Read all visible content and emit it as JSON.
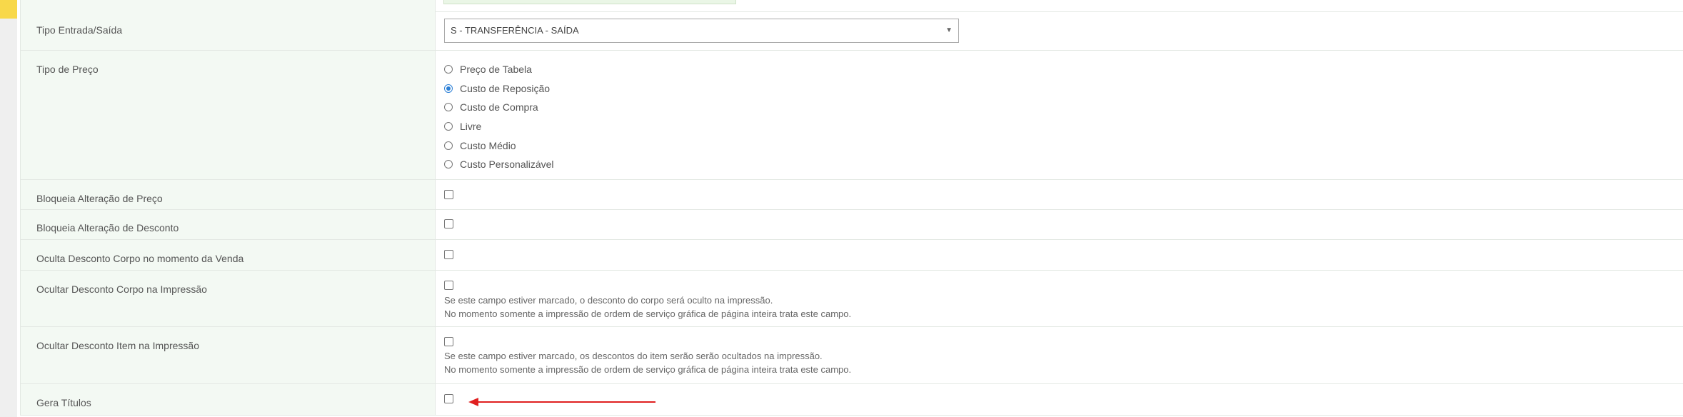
{
  "form": {
    "tipo_entrada_saida": {
      "label": "Tipo Entrada/Saída",
      "value": "S - TRANSFERÊNCIA - SAÍDA"
    },
    "tipo_preco": {
      "label": "Tipo de Preço",
      "options": [
        {
          "label": "Preço de Tabela",
          "checked": false
        },
        {
          "label": "Custo de Reposição",
          "checked": true
        },
        {
          "label": "Custo de Compra",
          "checked": false
        },
        {
          "label": "Livre",
          "checked": false
        },
        {
          "label": "Custo Médio",
          "checked": false
        },
        {
          "label": "Custo Personalizável",
          "checked": false
        }
      ]
    },
    "bloqueia_preco": {
      "label": "Bloqueia Alteração de Preço"
    },
    "bloqueia_desconto": {
      "label": "Bloqueia Alteração de Desconto"
    },
    "oculta_desconto_venda": {
      "label": "Oculta Desconto Corpo no momento da Venda"
    },
    "ocultar_desconto_corpo": {
      "label": "Ocultar Desconto Corpo na Impressão",
      "help1": "Se este campo estiver marcado, o desconto do corpo será oculto na impressão.",
      "help2": "No momento somente a impressão de ordem de serviço gráfica de página inteira trata este campo."
    },
    "ocultar_desconto_item": {
      "label": "Ocultar Desconto Item na Impressão",
      "help1": "Se este campo estiver marcado, os descontos do item serão serão ocultados na impressão.",
      "help2": "No momento somente a impressão de ordem de serviço gráfica de página inteira trata este campo."
    },
    "gera_titulos": {
      "label": "Gera Títulos"
    }
  },
  "colors": {
    "label_bg": "#f3f9f3",
    "accent": "#f8d84a",
    "arrow": "#e02020",
    "radio_checked": "#2b7fd6"
  },
  "icons": {
    "select_caret": "▼"
  }
}
